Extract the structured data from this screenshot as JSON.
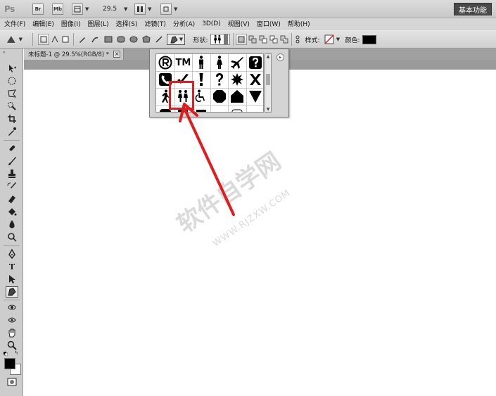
{
  "appbar": {
    "logo": "Ps",
    "btn_br": "Br",
    "btn_mb": "Mb",
    "zoom": "29.5",
    "workspace": "基本功能"
  },
  "menubar": {
    "items": [
      "文件(F)",
      "编辑(E)",
      "图像(I)",
      "图层(L)",
      "选择(S)",
      "滤镜(T)",
      "分析(A)",
      "3D(D)",
      "视图(V)",
      "窗口(W)",
      "帮助(H)"
    ]
  },
  "optbar": {
    "shape_label": "形状:",
    "style_label": "样式:",
    "color_label": "颜色:",
    "color_value": "#000000"
  },
  "document": {
    "tab_title": "未标题-1 @ 29.5%(RGB/8) *",
    "close_glyph": "×"
  },
  "shape_picker": {
    "shapes": [
      "registered-shape",
      "trademark-shape",
      "man-shape",
      "woman-shape",
      "airplane-shape",
      "question-box-shape",
      "phone-shape",
      "checkmark-shape",
      "exclamation-shape",
      "question-shape",
      "explosion-shape",
      "x-shape",
      "walking-man-shape",
      "two-people-shape",
      "wheelchair-shape",
      "octagon-shape",
      "house-shape",
      "triangle-down-shape"
    ],
    "trademark_text": "TM",
    "menu_glyph": "▸"
  },
  "watermark": {
    "text": "软件自学网",
    "url": "WWW.RJZXW.COM"
  },
  "colors": {
    "accent_red": "#e21c1c",
    "foreground": "#000000",
    "background": "#ffffff"
  }
}
